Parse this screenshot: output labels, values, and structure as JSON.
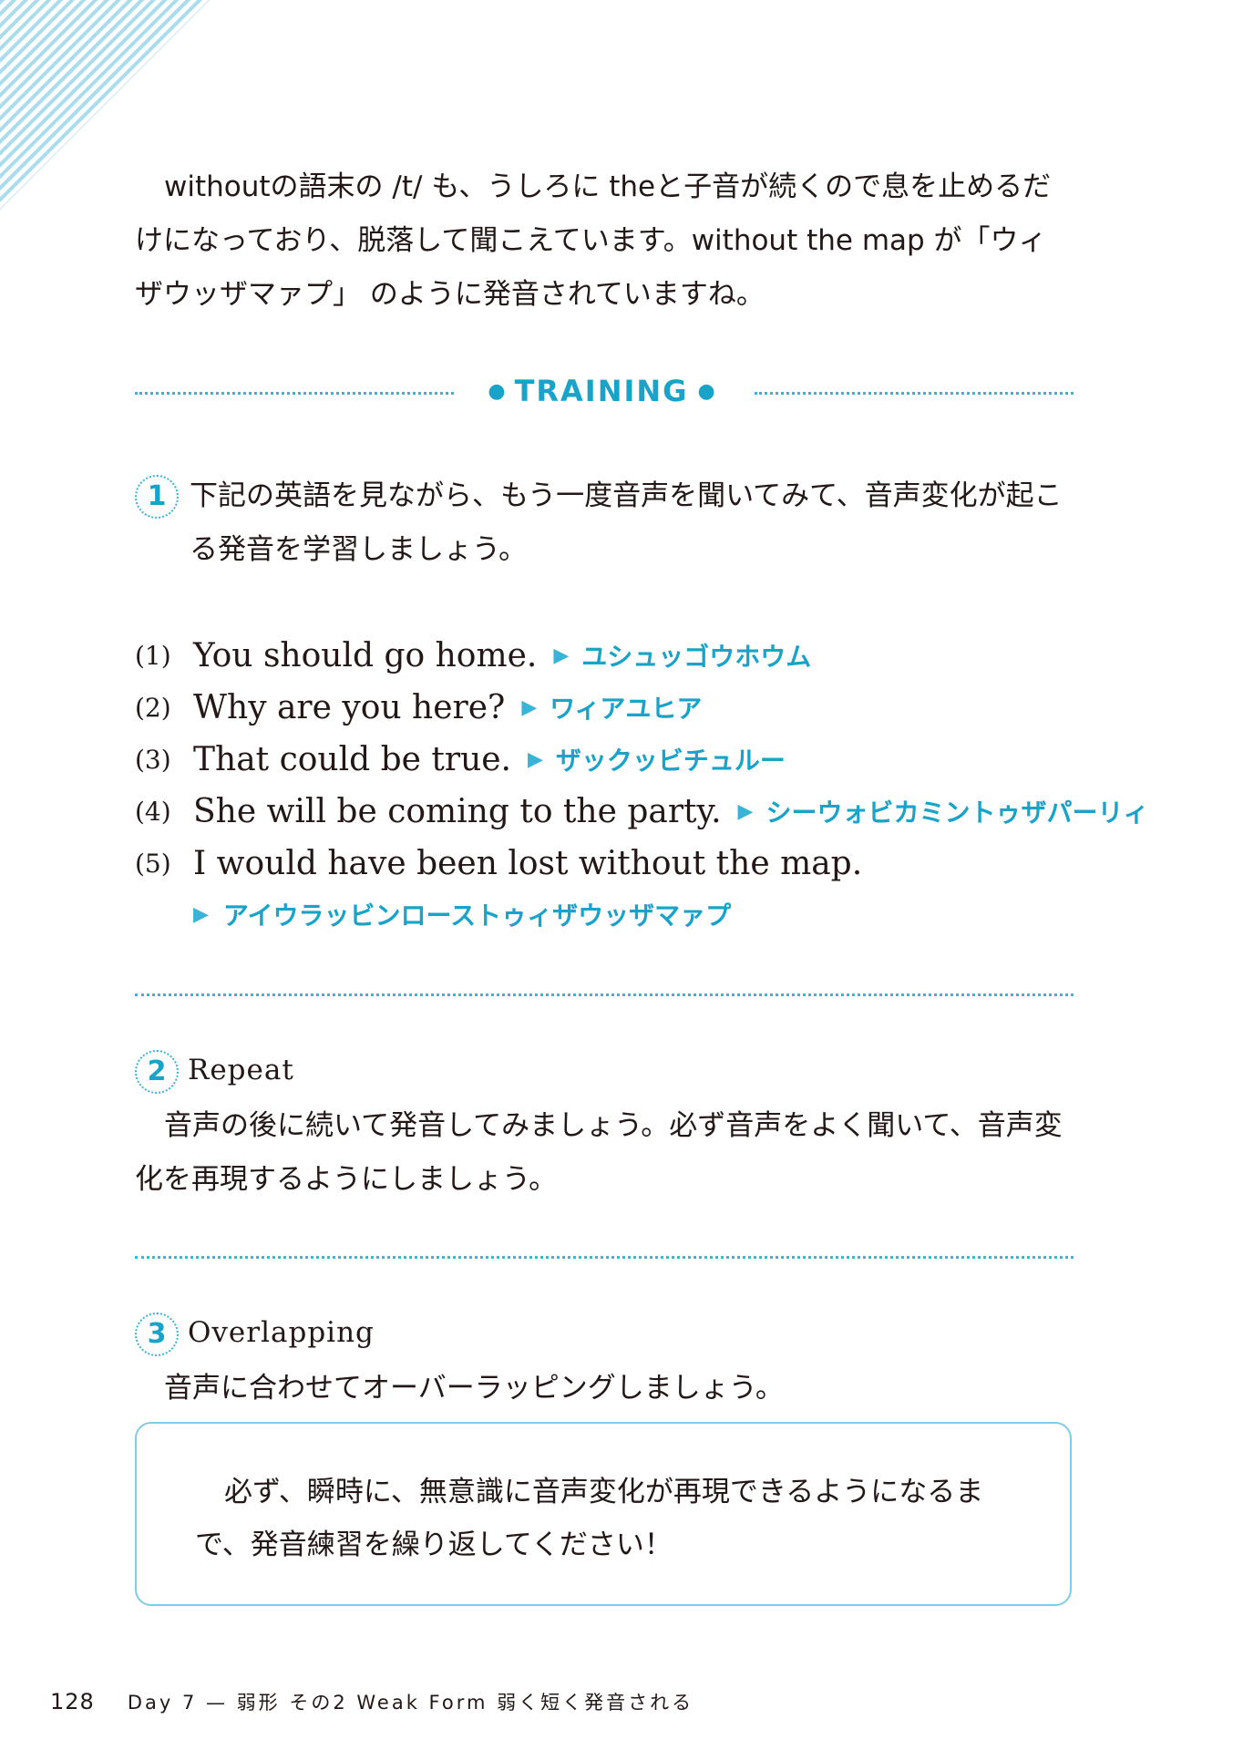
{
  "intro": {
    "paragraph": "withoutの語末の /t/ も、うしろに theと子音が続くので息を止めるだけになっており、脱落して聞こえています。without the map が「ウィザウッザマァプ」 のように発音されていますね。"
  },
  "training": {
    "label": "TRAINING",
    "bullet": "●"
  },
  "section1": {
    "number": "1",
    "instruction": "下記の英語を見ながら、もう一度音声を聞いてみて、音声変化が起こる発音を学習しましょう。",
    "arrow": "▶",
    "items": [
      {
        "index": "(1)",
        "english": "You should go home.",
        "katakana": "ユシュッゴウホウム"
      },
      {
        "index": "(2)",
        "english": "Why are you here?",
        "katakana": "ワィアユヒア"
      },
      {
        "index": "(3)",
        "english": "That could be true.",
        "katakana": "ザックッビチュルー"
      },
      {
        "index": "(4)",
        "english": "She will be coming to the party.",
        "katakana": "シーウォビカミントゥザパーリィ"
      },
      {
        "index": "(5)",
        "english": "I would have been lost without the map.",
        "katakana": "アイウラッビンローストゥィザウッザマァプ"
      }
    ]
  },
  "section2": {
    "number": "2",
    "title": "Repeat",
    "text": "音声の後に続いて発音してみましょう。必ず音声をよく聞いて、音声変化を再現するようにしましょう。"
  },
  "section3": {
    "number": "3",
    "title": "Overlapping",
    "text": "音声に合わせてオーバーラッピングしましょう。"
  },
  "note": {
    "text": "必ず、瞬時に、無意識に音声変化が再現できるようになるまで、発音練習を繰り返してください！"
  },
  "footer": {
    "page_number": "128",
    "running_head": "Day 7 — 弱形 その2 Weak Form 弱く短く発音される"
  },
  "colors": {
    "accent": "#1aa3c9",
    "rule": "#39b4d6",
    "box_border": "#7ecde3",
    "text": "#231815"
  }
}
